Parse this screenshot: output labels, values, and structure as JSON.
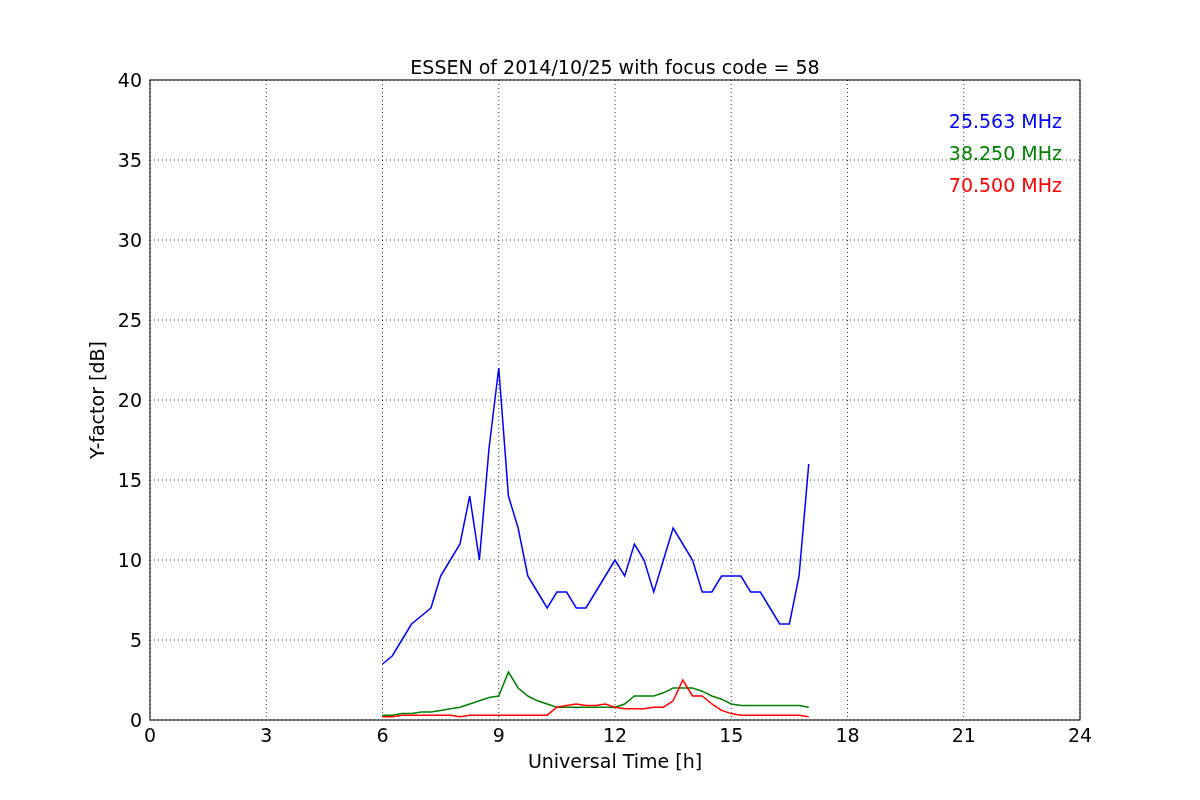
{
  "figure": {
    "chart_data": {
      "type": "line",
      "title": "ESSEN of 2014/10/25 with focus code = 58",
      "xlabel": "Universal Time [h]",
      "ylabel": "Y-factor [dB]",
      "x": [
        6,
        6.25,
        6.5,
        6.75,
        7,
        7.25,
        7.5,
        7.75,
        8,
        8.25,
        8.5,
        8.75,
        9,
        9.25,
        9.5,
        9.75,
        10,
        10.25,
        10.5,
        10.75,
        11,
        11.25,
        11.5,
        11.75,
        12,
        12.25,
        12.5,
        12.75,
        13,
        13.25,
        13.5,
        13.75,
        14,
        14.25,
        14.5,
        14.75,
        15,
        15.25,
        15.5,
        15.75,
        16,
        16.25,
        16.5,
        16.75,
        17
      ],
      "series": [
        {
          "name": "25.563 MHz",
          "color": "#0000ff",
          "values": [
            3.5,
            4,
            5,
            6,
            6.5,
            7,
            9,
            10,
            11,
            14,
            10,
            17,
            22,
            14,
            12,
            9,
            8,
            7,
            8,
            8,
            7,
            7,
            8,
            9,
            10,
            9,
            11,
            10,
            8,
            10,
            12,
            11,
            10,
            8,
            8,
            9,
            9,
            9,
            8,
            8,
            7,
            6,
            6,
            9,
            16
          ]
        },
        {
          "name": "38.250 MHz",
          "color": "#008000",
          "values": [
            0.3,
            0.3,
            0.4,
            0.4,
            0.5,
            0.5,
            0.6,
            0.7,
            0.8,
            1,
            1.2,
            1.4,
            1.5,
            3,
            2,
            1.5,
            1.2,
            1,
            0.8,
            0.8,
            0.8,
            0.8,
            0.8,
            0.8,
            0.8,
            1,
            1.5,
            1.5,
            1.5,
            1.7,
            2,
            2,
            2,
            1.8,
            1.5,
            1.3,
            1,
            0.9,
            0.9,
            0.9,
            0.9,
            0.9,
            0.9,
            0.9,
            0.8
          ]
        },
        {
          "name": "70.500 MHz",
          "color": "#ff0000",
          "values": [
            0.2,
            0.2,
            0.3,
            0.3,
            0.3,
            0.3,
            0.3,
            0.3,
            0.2,
            0.3,
            0.3,
            0.3,
            0.3,
            0.3,
            0.3,
            0.3,
            0.3,
            0.3,
            0.8,
            0.9,
            1,
            0.9,
            0.9,
            1,
            0.8,
            0.7,
            0.7,
            0.7,
            0.8,
            0.8,
            1.2,
            2.5,
            1.5,
            1.5,
            1,
            0.6,
            0.4,
            0.3,
            0.3,
            0.3,
            0.3,
            0.3,
            0.3,
            0.3,
            0.2
          ]
        }
      ],
      "grid": true,
      "xlim": [
        0,
        24
      ],
      "ylim": [
        0,
        40
      ],
      "xticks": [
        0,
        3,
        6,
        9,
        12,
        15,
        18,
        21,
        24
      ],
      "yticks": [
        0,
        5,
        10,
        15,
        20,
        25,
        30,
        35,
        40
      ]
    }
  }
}
